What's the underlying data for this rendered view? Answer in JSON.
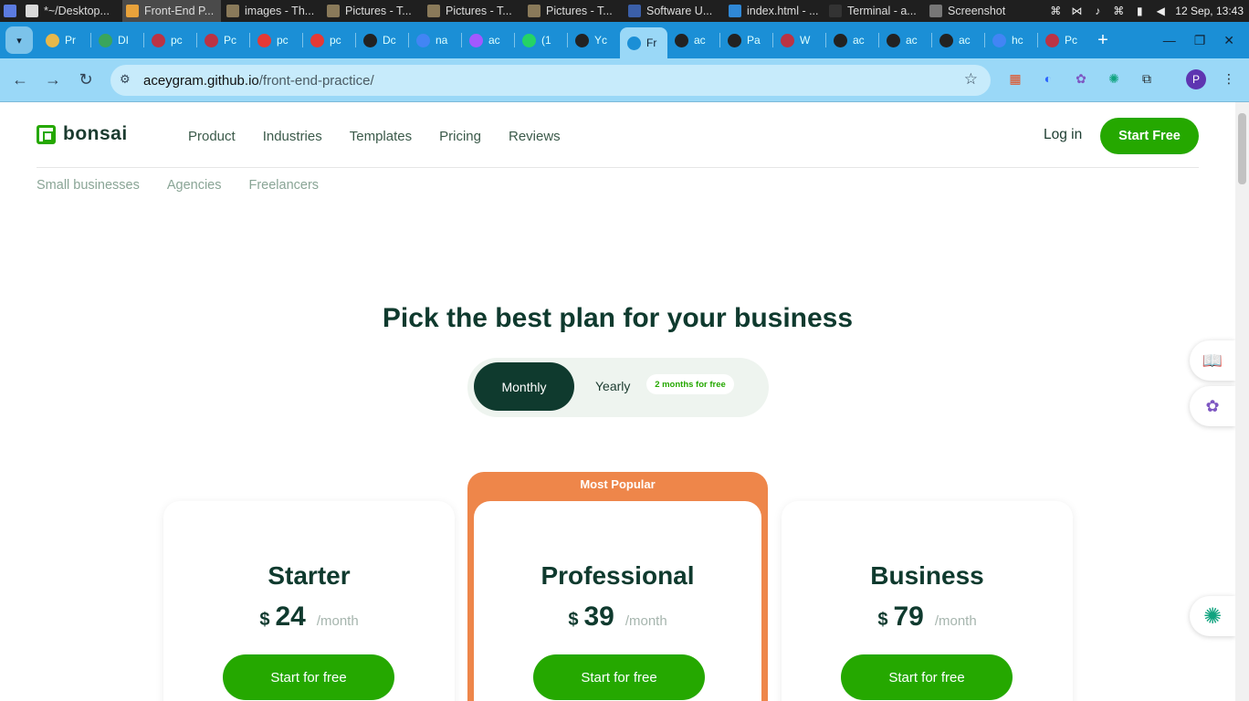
{
  "taskbar": {
    "tasks": [
      {
        "label": "",
        "color": "#5b7be0"
      },
      {
        "label": "*~/Desktop...",
        "color": "#d9d9d9"
      },
      {
        "label": "Front-End P...",
        "color": "#e8a23b",
        "active": true
      },
      {
        "label": "images - Th...",
        "color": "#8a7a5a"
      },
      {
        "label": "Pictures - T...",
        "color": "#8a7a5a"
      },
      {
        "label": "Pictures - T...",
        "color": "#8a7a5a"
      },
      {
        "label": "Pictures - T...",
        "color": "#8a7a5a"
      },
      {
        "label": "Software U...",
        "color": "#3b5fa8"
      },
      {
        "label": "index.html - ...",
        "color": "#2f88d6"
      },
      {
        "label": "Terminal - a...",
        "color": "#333"
      },
      {
        "label": "Screenshot",
        "color": "#777"
      }
    ],
    "clock": "12 Sep, 13:43"
  },
  "tabs": [
    {
      "label": "Pr",
      "color": "#e8b84a"
    },
    {
      "label": "DI",
      "color": "#3aa55c"
    },
    {
      "label": "pc",
      "color": "#b34"
    },
    {
      "label": "Pc",
      "color": "#b34"
    },
    {
      "label": "pc",
      "color": "#e53935"
    },
    {
      "label": "pc",
      "color": "#e53935"
    },
    {
      "label": "Dc",
      "color": "#222"
    },
    {
      "label": "na",
      "color": "#4285f4"
    },
    {
      "label": "ac",
      "color": "#a259ff"
    },
    {
      "label": "(1",
      "color": "#25d366"
    },
    {
      "label": "Yc",
      "color": "#222"
    },
    {
      "label": "Fr",
      "color": "#1b8fd6",
      "current": true
    },
    {
      "label": "ac",
      "color": "#222"
    },
    {
      "label": "Pa",
      "color": "#222"
    },
    {
      "label": "W",
      "color": "#b34"
    },
    {
      "label": "ac",
      "color": "#222"
    },
    {
      "label": "ac",
      "color": "#222"
    },
    {
      "label": "ac",
      "color": "#222"
    },
    {
      "label": "hc",
      "color": "#4285f4"
    },
    {
      "label": "Pc",
      "color": "#b34"
    }
  ],
  "browser": {
    "url_domain": "aceygram.github.io",
    "url_path": "/front-end-practice/",
    "profile_initial": "P"
  },
  "site": {
    "brand": "bonsai",
    "nav": [
      "Product",
      "Industries",
      "Templates",
      "Pricing",
      "Reviews"
    ],
    "login": "Log in",
    "start_free": "Start Free",
    "subnav": [
      "Small businesses",
      "Agencies",
      "Freelancers"
    ],
    "heading": "Pick the best plan for your business",
    "toggle": {
      "monthly": "Monthly",
      "yearly": "Yearly",
      "badge": "2 months for free"
    },
    "popular_label": "Most Popular",
    "plans": [
      {
        "name": "Starter",
        "currency": "$",
        "price": "24",
        "period": "/month",
        "cta": "Start for free"
      },
      {
        "name": "Professional",
        "currency": "$",
        "price": "39",
        "period": "/month",
        "cta": "Start for free"
      },
      {
        "name": "Business",
        "currency": "$",
        "price": "79",
        "period": "/month",
        "cta": "Start for free"
      }
    ]
  },
  "colors": {
    "brand_green": "#25a800",
    "dark_green": "#0f3a2e",
    "popular_orange": "#ee864a",
    "tab_bar": "#1b8fd6",
    "address_bar": "#9ad8f7"
  }
}
